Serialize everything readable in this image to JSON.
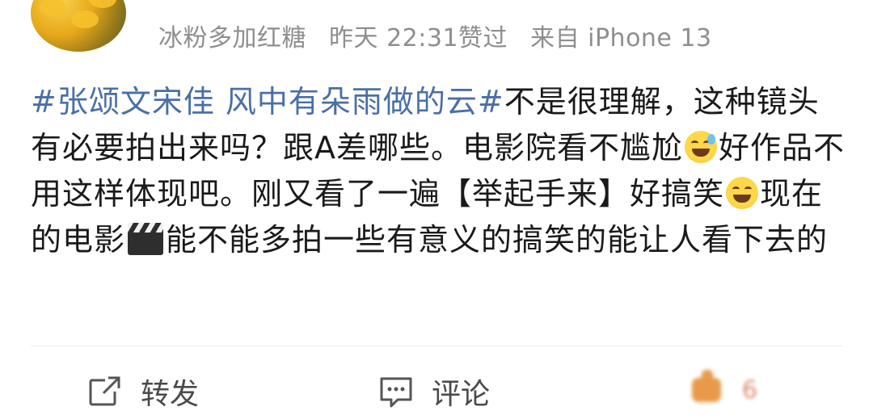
{
  "post": {
    "username_hidden": true,
    "meta": {
      "liker": "冰粉多加红糖",
      "time": "昨天 22:31",
      "liked_label": "赞过",
      "source": "来自 iPhone 13"
    },
    "content": {
      "topic": "#张颂文宋佳 风中有朵雨做的云#",
      "part1": "不是很理解，这种镜头有必要拍出来吗？跟A差哪些。电影院看不尴尬",
      "emoji1": "sweat-smile",
      "part2": "好作品不用这样体现吧。刚又看了一遍【举起手来】好搞笑",
      "emoji2": "laughing",
      "part3": "现在的电影",
      "emoji3": "clapper-board",
      "part4": "能不能多拍一些有意义的搞笑的能让人看下去的"
    }
  },
  "actions": {
    "repost_label": "转发",
    "comment_label": "评论",
    "like_count": "6"
  },
  "colors": {
    "topic": "#4a6fa6",
    "meta": "#8e8e8e",
    "like": "#e89a4a"
  }
}
